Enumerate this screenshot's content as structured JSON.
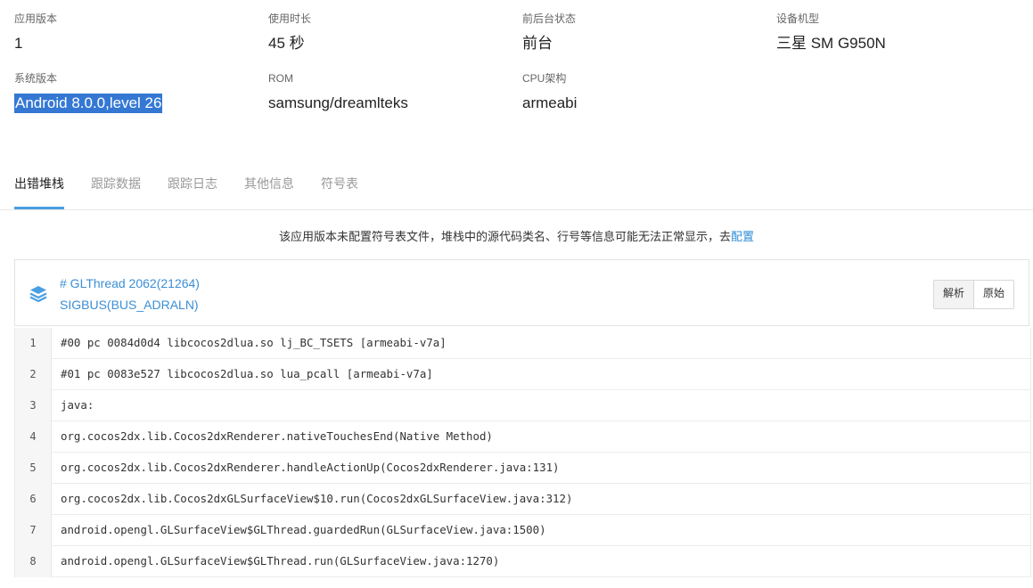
{
  "info": [
    {
      "label": "应用版本",
      "value": "1"
    },
    {
      "label": "使用时长",
      "value": "45 秒"
    },
    {
      "label": "前后台状态",
      "value": "前台"
    },
    {
      "label": "设备机型",
      "value": "三星 SM G950N"
    },
    {
      "label": "系统版本",
      "value": "Android 8.0.0,level 26"
    },
    {
      "label": "ROM",
      "value": "samsung/dreamlteks"
    },
    {
      "label": "CPU架构",
      "value": "armeabi"
    }
  ],
  "tabs": [
    "出错堆栈",
    "跟踪数据",
    "跟踪日志",
    "其他信息",
    "符号表"
  ],
  "active_tab": "出错堆栈",
  "notice": {
    "text": "该应用版本未配置符号表文件，堆栈中的源代码类名、行号等信息可能无法正常显示，去",
    "link": "配置"
  },
  "thread": {
    "title": "# GLThread 2062(21264)",
    "signal": "SIGBUS(BUS_ADRALN)",
    "buttons": {
      "parse": "解析",
      "raw": "原始"
    }
  },
  "stack": [
    {
      "line": "1",
      "text": "#00 pc 0084d0d4 libcocos2dlua.so lj_BC_TSETS [armeabi-v7a]"
    },
    {
      "line": "2",
      "text": "#01 pc 0083e527 libcocos2dlua.so lua_pcall [armeabi-v7a]"
    },
    {
      "line": "3",
      "text": "java:"
    },
    {
      "line": "4",
      "text": "org.cocos2dx.lib.Cocos2dxRenderer.nativeTouchesEnd(Native Method)"
    },
    {
      "line": "5",
      "text": "org.cocos2dx.lib.Cocos2dxRenderer.handleActionUp(Cocos2dxRenderer.java:131)"
    },
    {
      "line": "6",
      "text": "org.cocos2dx.lib.Cocos2dxGLSurfaceView$10.run(Cocos2dxGLSurfaceView.java:312)"
    },
    {
      "line": "7",
      "text": "android.opengl.GLSurfaceView$GLThread.guardedRun(GLSurfaceView.java:1500)"
    },
    {
      "line": "8",
      "text": "android.opengl.GLSurfaceView$GLThread.run(GLSurfaceView.java:1270)"
    }
  ],
  "colors": {
    "accent": "#4a9fe3",
    "link": "#2d8cd8",
    "selection": "#3478d4"
  },
  "icons": {
    "thread": "layers-icon"
  }
}
